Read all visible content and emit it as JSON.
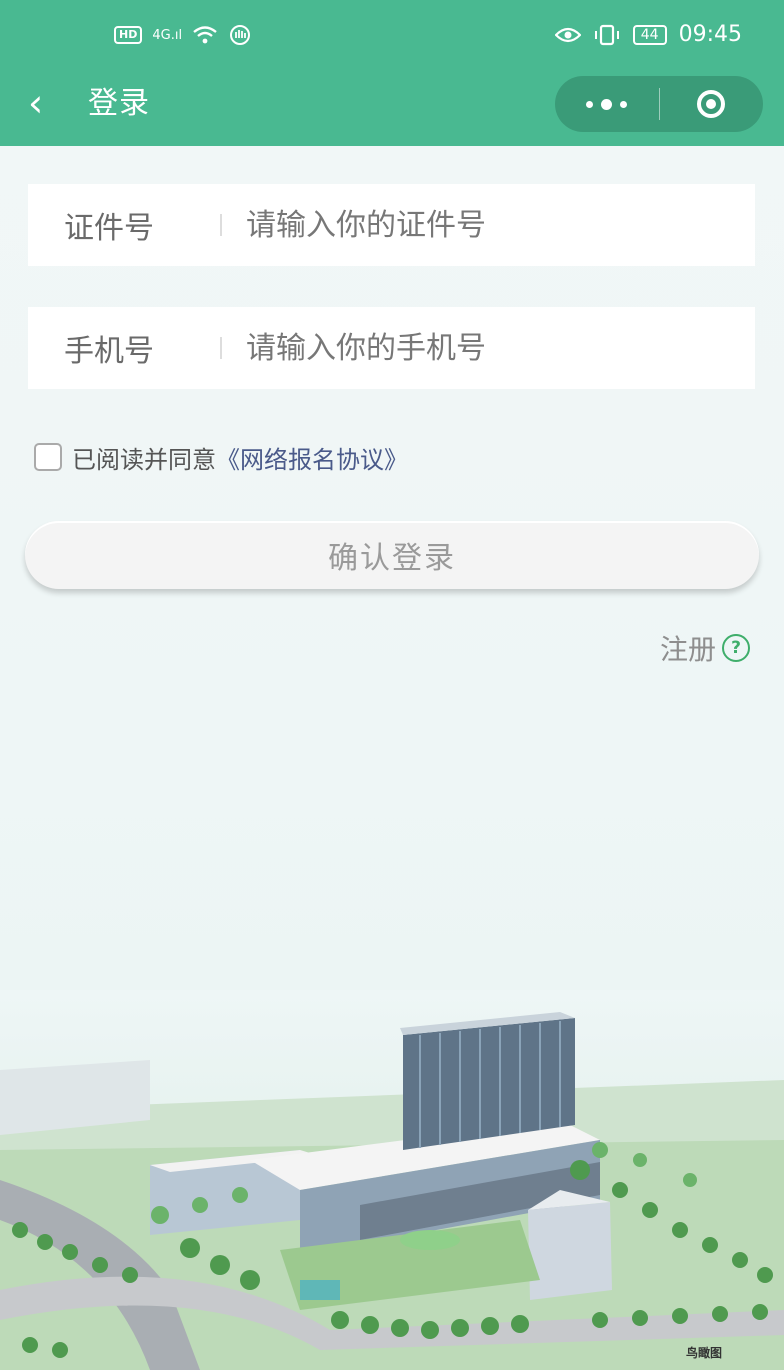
{
  "status_bar": {
    "left_badge": "HD",
    "network": "4G",
    "battery": "44",
    "time": "09:45"
  },
  "nav": {
    "back_glyph": "‹",
    "title": "登录"
  },
  "form": {
    "id_label": "证件号",
    "id_placeholder": "请输入你的证件号",
    "phone_label": "手机号",
    "phone_placeholder": "请输入你的手机号"
  },
  "agreement": {
    "prefix": "已阅读并同意",
    "link": "《网络报名协议》",
    "checked": false
  },
  "login_button": "确认登录",
  "register": {
    "label": "注册",
    "help_glyph": "?"
  },
  "illustration": {
    "caption": "鸟瞰图"
  },
  "colors": {
    "accent": "#49b991",
    "capsule": "#3a9b78",
    "link": "#4a5a8a",
    "help": "#3fae6b"
  },
  "icons": [
    "hd-icon",
    "signal-icon",
    "wifi-icon",
    "hand-icon",
    "eye-icon",
    "vibrate-icon",
    "battery-icon",
    "back-icon",
    "more-icon",
    "close-mini-program-icon",
    "help-icon"
  ]
}
